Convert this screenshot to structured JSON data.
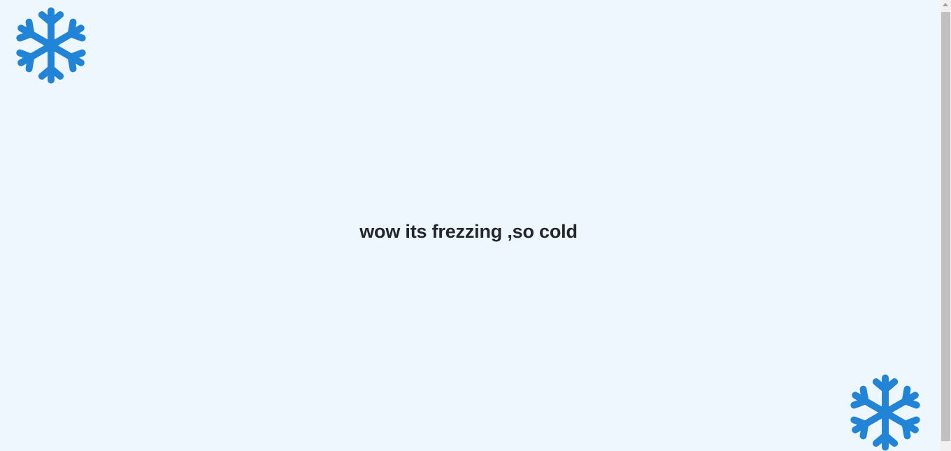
{
  "main": {
    "headline": "wow its frezzing ,so cold"
  },
  "decorations": {
    "top_left_icon": "snowflake-icon",
    "bottom_right_icon": "snowflake-icon",
    "icon_color": "#2284d6"
  },
  "colors": {
    "background": "#eef7fe",
    "text": "#23272b"
  }
}
